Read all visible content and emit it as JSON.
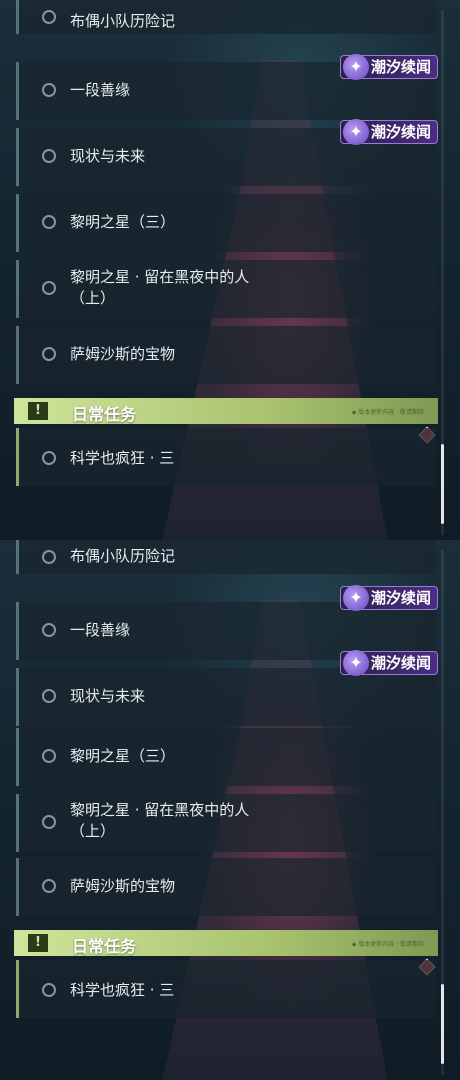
{
  "panels": [
    {
      "quests": [
        {
          "label": "布偶小队历险记"
        },
        {
          "label": "一段善缘",
          "badge": "潮汐续闻"
        },
        {
          "label": "现状与未来",
          "badge": "潮汐续闻"
        },
        {
          "label": "黎明之星（三）"
        },
        {
          "label_line1": "黎明之星 · 留在黑夜中的人",
          "label_line2": "（上）"
        },
        {
          "label": "萨姆沙斯的宝物"
        }
      ],
      "section": {
        "title": "日常任务",
        "icon": "exclamation-icon",
        "stamp": "◆ 版本更新内容 · 敬请期待"
      },
      "daily_quest": {
        "label": "科学也疯狂 · 三"
      }
    },
    {
      "quests": [
        {
          "label": "布偶小队历险记"
        },
        {
          "label": "一段善缘",
          "badge": "潮汐续闻"
        },
        {
          "label": "现状与未来",
          "badge": "潮汐续闻"
        },
        {
          "label": "黎明之星（三）"
        },
        {
          "label_line1": "黎明之星 · 留在黑夜中的人",
          "label_line2": "（上）"
        },
        {
          "label": "萨姆沙斯的宝物"
        }
      ],
      "section": {
        "title": "日常任务",
        "icon": "exclamation-icon",
        "stamp": "◆ 版本更新内容 · 敬请期待"
      },
      "daily_quest": {
        "label": "科学也疯狂 · 三"
      }
    }
  ],
  "colors": {
    "section_accent": "#cfe59b",
    "badge_purple": "#4b2e83",
    "alert_diamond": "#e0505c"
  }
}
